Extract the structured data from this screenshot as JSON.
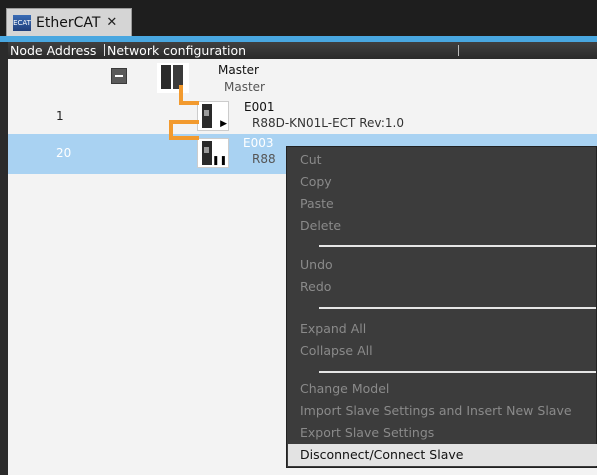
{
  "tab": {
    "icon_text": "ECAT",
    "title": "EtherCAT",
    "close": "✕"
  },
  "header": {
    "node_address": "Node Address",
    "network_configuration": "Network configuration"
  },
  "rows": [
    {
      "node": "",
      "name": "Master",
      "sub": "Master"
    },
    {
      "node": "1",
      "name": "E001",
      "sub": "R88D-KN01L-ECT Rev:1.0"
    },
    {
      "node": "20",
      "name": "E003",
      "sub": "R88"
    }
  ],
  "menu": {
    "cut": "Cut",
    "copy": "Copy",
    "paste": "Paste",
    "delete": "Delete",
    "undo": "Undo",
    "redo": "Redo",
    "expand_all": "Expand All",
    "collapse_all": "Collapse All",
    "change_model": "Change Model",
    "import_slave": "Import Slave Settings and Insert New Slave",
    "export_slave": "Export Slave Settings",
    "disconnect": "Disconnect/Connect Slave"
  },
  "colors": {
    "accent": "#49a7e0",
    "selection": "#a9d2f2",
    "connector": "#f29a2e"
  },
  "icons": [
    "ethercat-tab-icon",
    "close-icon",
    "collapse-icon",
    "master-device-icon",
    "slave-device-icon"
  ]
}
